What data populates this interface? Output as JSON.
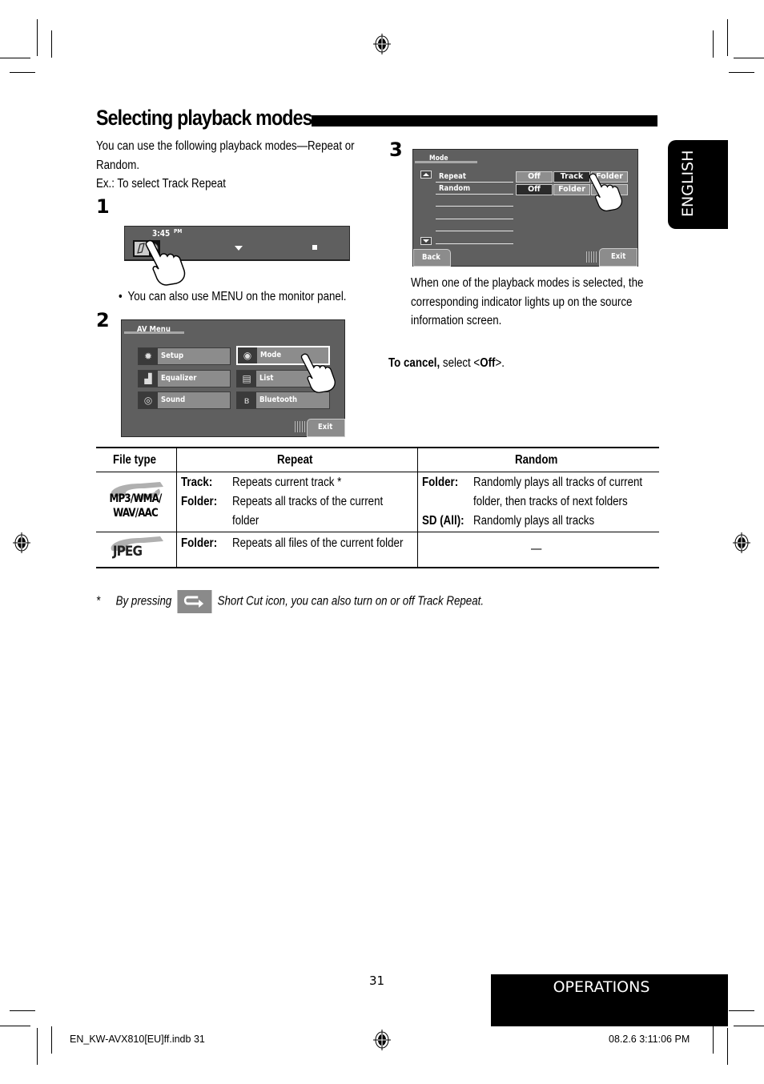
{
  "title": "Selecting playback modes",
  "intro": {
    "line1": "You can use the following playback modes—Repeat or",
    "line2": "Random.",
    "line3": "Ex.: To select Track Repeat"
  },
  "steps": {
    "step1": {
      "number": "1",
      "screen": {
        "time": "3:45",
        "ampm": "PM",
        "icon": "av-menu-icon"
      },
      "note": "You can also use MENU on the monitor panel."
    },
    "step2": {
      "number": "2",
      "screen": {
        "title": "AV Menu",
        "buttons": [
          {
            "label": "Setup",
            "icon": "gear-icon",
            "selected": false
          },
          {
            "label": "Mode",
            "icon": "mode-dial-icon",
            "selected": true
          },
          {
            "label": "Equalizer",
            "icon": "equalizer-icon",
            "selected": false
          },
          {
            "label": "List",
            "icon": "list-icon",
            "selected": false
          },
          {
            "label": "Sound",
            "icon": "sound-icon",
            "selected": false
          },
          {
            "label": "Bluetooth",
            "icon": "bluetooth-icon",
            "selected": false
          }
        ],
        "exit": "Exit"
      }
    },
    "step3": {
      "number": "3",
      "screen": {
        "title": "Mode",
        "rows": [
          {
            "label": "Repeat",
            "options": [
              {
                "label": "Off",
                "active": false
              },
              {
                "label": "Track",
                "active": true
              },
              {
                "label": "Folder",
                "active": false
              }
            ]
          },
          {
            "label": "Random",
            "options": [
              {
                "label": "Off",
                "active": true
              },
              {
                "label": "Folder",
                "active": false
              },
              {
                "label": "",
                "active": false
              }
            ]
          }
        ],
        "back": "Back",
        "exit": "Exit"
      },
      "description": {
        "line1": "When one of the playback modes is selected, the",
        "line2": "corresponding indicator lights up on the source",
        "line3": "information screen."
      }
    }
  },
  "cancel": {
    "bold": "To cancel,",
    "text": " select <",
    "off": "Off",
    "end": ">."
  },
  "table": {
    "headers": [
      "File type",
      "Repeat",
      "Random"
    ],
    "rows": [
      {
        "file_type": {
          "line1": "MP3/WMA/",
          "line2": "WAV/AAC",
          "icon": "sd-card-icon"
        },
        "repeat": [
          {
            "key": "Track",
            "lines": [
              "Repeats current track *"
            ]
          },
          {
            "key": "Folder",
            "lines": [
              "Repeats all tracks of the current",
              "folder"
            ]
          }
        ],
        "random": [
          {
            "key": "Folder",
            "lines": [
              "Randomly plays all tracks of current",
              "folder, then tracks of next folders"
            ]
          },
          {
            "key": "SD (All)",
            "lines": [
              "Randomly plays all tracks"
            ]
          }
        ]
      },
      {
        "file_type": {
          "line1": "JPEG",
          "icon": "sd-card-icon"
        },
        "repeat": [
          {
            "key": "Folder",
            "lines": [
              "Repeats all files of the current folder"
            ]
          }
        ],
        "random_text": "—"
      }
    ]
  },
  "footnote": {
    "star": "*",
    "before": "By pressing",
    "icon": "short-cut-repeat-icon",
    "after": "Short Cut icon, you can also turn on or off Track Repeat."
  },
  "side_tab": "ENGLISH",
  "section_tab": "OPERATIONS",
  "page_number": "31",
  "footer": {
    "file": "EN_KW-AVX810[EU]ff.indb   31",
    "timestamp": "08.2.6   3:11:06 PM"
  }
}
